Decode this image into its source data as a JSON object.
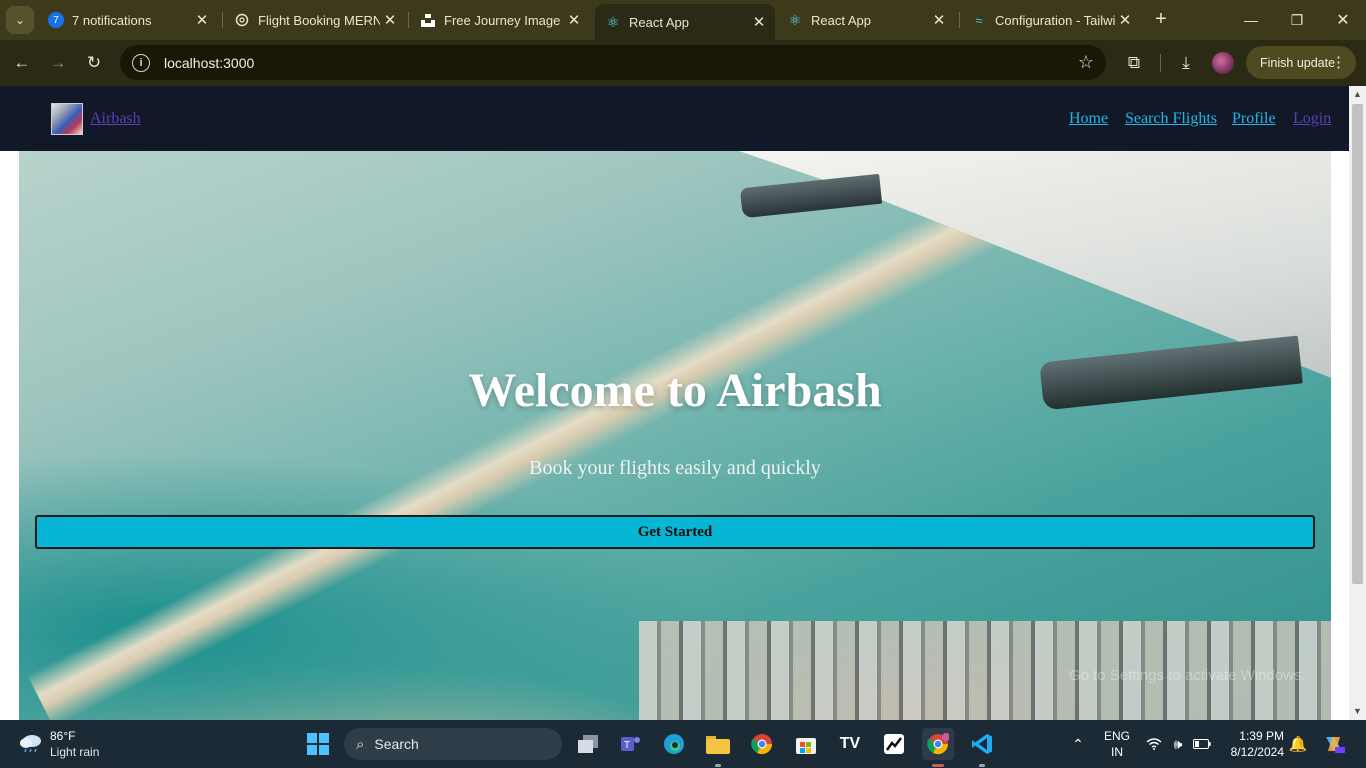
{
  "browser": {
    "tabs": [
      {
        "title": "7 notifications",
        "badge": "7"
      },
      {
        "title": "Flight Booking MERN"
      },
      {
        "title": "Free Journey Image o"
      },
      {
        "title": "React App"
      },
      {
        "title": "React App"
      },
      {
        "title": "Configuration - Tailwi"
      }
    ],
    "url": "localhost:3000",
    "finish_update_label": "Finish update"
  },
  "page": {
    "brand": "Airbash",
    "nav": [
      "Home",
      "Search Flights",
      "Profile",
      "Login"
    ],
    "hero_title": "Welcome to Airbash",
    "hero_subtitle": "Book your flights easily and quickly",
    "cta_label": "Get Started",
    "watermark": "Go to Settings to activate Windows."
  },
  "taskbar": {
    "weather_temp": "86°F",
    "weather_desc": "Light rain",
    "search_placeholder": "Search",
    "lang_line1": "ENG",
    "lang_line2": "IN",
    "time": "1:39 PM",
    "date": "8/12/2024"
  },
  "colors": {
    "navbar_bg": "#111827",
    "nav_link": "#22b8e8",
    "cta_bg": "#06b6d4",
    "browser_frame": "#3d3a1c"
  }
}
